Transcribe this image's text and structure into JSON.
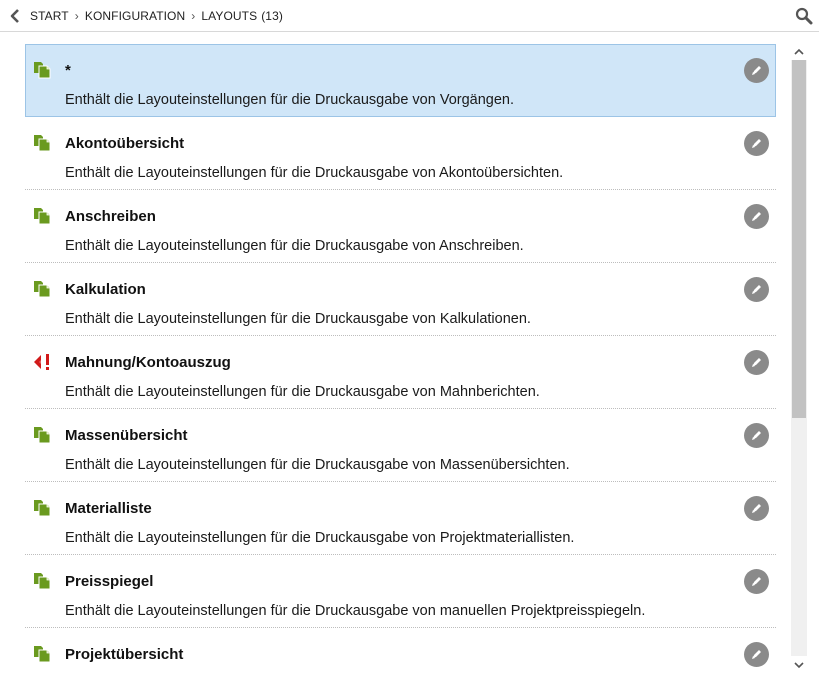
{
  "header": {
    "breadcrumb": [
      "START",
      "KONFIGURATION",
      "LAYOUTS"
    ],
    "count": "(13)"
  },
  "colors": {
    "accent_green": "#6a9a1f",
    "selected_bg": "#d0e6f8",
    "warning_red": "#d11a1a",
    "edit_button": "#8a8a8a"
  },
  "items": [
    {
      "title": "*",
      "desc": "Enthält die Layouteinstellungen für die Druckausgabe von Vorgängen.",
      "icon": "document-copy-icon",
      "selected": true
    },
    {
      "title": "Akontoübersicht",
      "desc": "Enthält die Layouteinstellungen für die Druckausgabe von Akontoübersichten.",
      "icon": "document-copy-icon"
    },
    {
      "title": "Anschreiben",
      "desc": "Enthält die Layouteinstellungen für die Druckausgabe von Anschreiben.",
      "icon": "document-copy-icon"
    },
    {
      "title": "Kalkulation",
      "desc": "Enthält die Layouteinstellungen für die Druckausgabe von Kalkulationen.",
      "icon": "document-copy-icon"
    },
    {
      "title": "Mahnung/Kontoauszug",
      "desc": "Enthält die Layouteinstellungen für die Druckausgabe von Mahnberichten.",
      "icon": "dunning-warning-icon"
    },
    {
      "title": "Massenübersicht",
      "desc": "Enthält die Layouteinstellungen für die Druckausgabe von Massenübersichten.",
      "icon": "document-copy-icon"
    },
    {
      "title": "Materialliste",
      "desc": "Enthält die Layouteinstellungen für die Druckausgabe von Projektmateriallisten.",
      "icon": "document-copy-icon"
    },
    {
      "title": "Preisspiegel",
      "desc": "Enthält die Layouteinstellungen für die Druckausgabe von manuellen Projektpreisspiegeln.",
      "icon": "document-copy-icon"
    },
    {
      "title": "Projektübersicht",
      "desc": "",
      "icon": "document-copy-icon"
    }
  ]
}
